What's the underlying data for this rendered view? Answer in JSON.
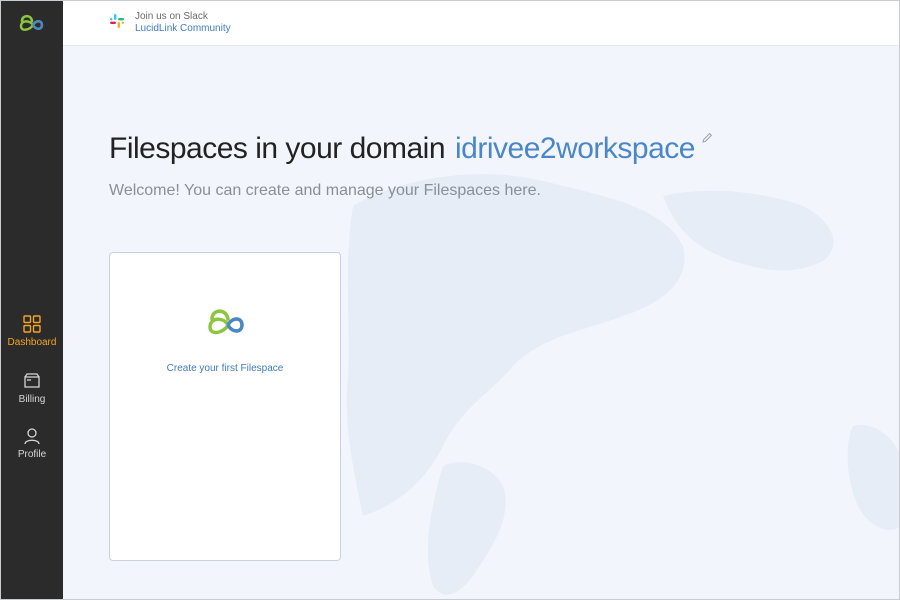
{
  "sidebar": {
    "items": [
      {
        "label": "Dashboard",
        "icon": "grid-icon",
        "active": true
      },
      {
        "label": "Billing",
        "icon": "wallet-icon",
        "active": false
      },
      {
        "label": "Profile",
        "icon": "user-icon",
        "active": false
      }
    ]
  },
  "topbar": {
    "slack_line1": "Join us on Slack",
    "slack_line2": "LucidLink Community"
  },
  "main": {
    "title": "Filespaces in your domain",
    "domain": "idrivee2workspace",
    "subtitle": "Welcome! You can create and manage your Filespaces here.",
    "card_label": "Create your first Filespace"
  },
  "colors": {
    "sidebar_bg": "#2b2b2b",
    "accent_active": "#f5a623",
    "link_blue": "#3f7bc1",
    "logo_green": "#8cc63f",
    "logo_blue": "#4a86c8",
    "main_bg": "#f2f6fc"
  }
}
